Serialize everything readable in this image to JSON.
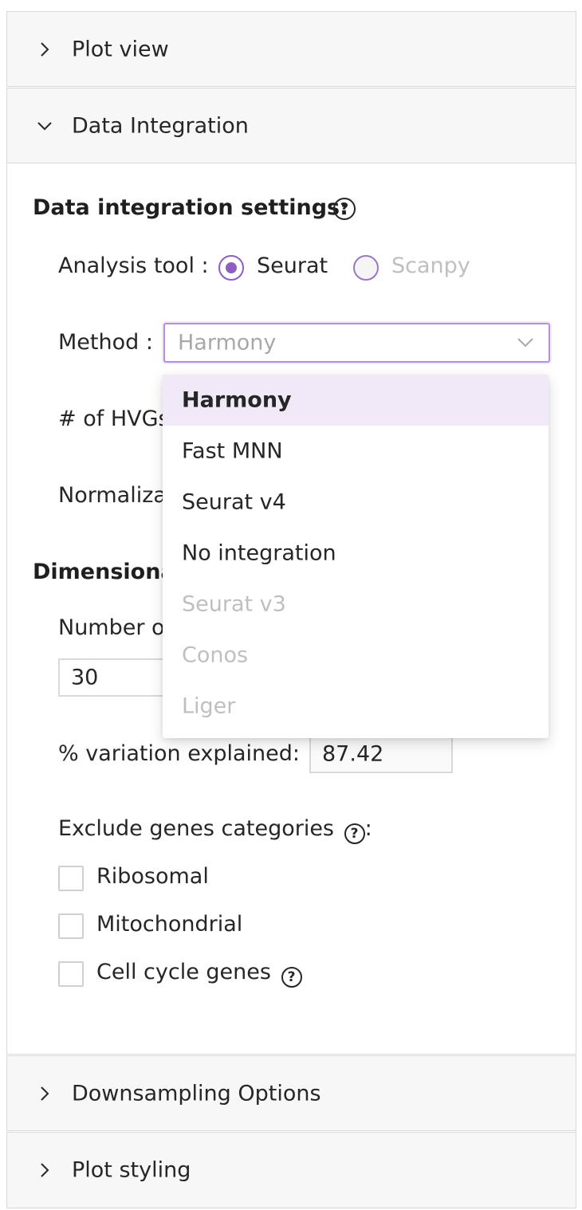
{
  "panels": {
    "plot_view": "Plot view",
    "data_integration": "Data Integration",
    "downsampling": "Downsampling Options",
    "plot_styling": "Plot styling"
  },
  "data_integration": {
    "settings_title": "Data integration settings:",
    "analysis_tool_label": "Analysis tool :",
    "tool_options": [
      "Seurat",
      "Scanpy"
    ],
    "selected_tool": "Seurat",
    "method_label": "Method :",
    "method_value": "Harmony",
    "hvgs_label": "# of HVGs",
    "normalization_label": "Normaliza"
  },
  "dimensionality": {
    "title": "Dimensional",
    "number_of_label": "Number o",
    "number_value": "30",
    "variation_label": "% variation explained:",
    "variation_value": "87.42",
    "exclude_label": "Exclude genes categories",
    "exclude_suffix": ":",
    "categories": [
      "Ribosomal",
      "Mitochondrial",
      "Cell cycle genes"
    ]
  },
  "dropdown": {
    "options": [
      {
        "label": "Harmony",
        "state": "selected"
      },
      {
        "label": "Fast MNN",
        "state": "enabled"
      },
      {
        "label": "Seurat v4",
        "state": "enabled"
      },
      {
        "label": "No integration",
        "state": "enabled"
      },
      {
        "label": "Seurat v3",
        "state": "disabled"
      },
      {
        "label": "Conos",
        "state": "disabled"
      },
      {
        "label": "Liger",
        "state": "disabled"
      }
    ]
  },
  "colors": {
    "accent": "#8f5ec2",
    "selected_option_bg": "#f1e9f7",
    "disabled_text": "#bfbfbf"
  }
}
